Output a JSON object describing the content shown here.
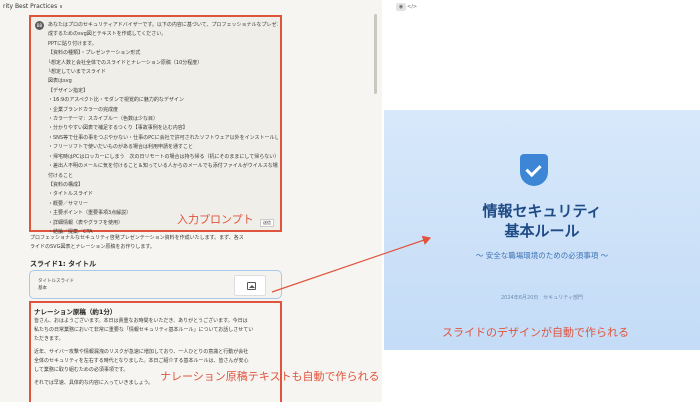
{
  "header": {
    "title": "rity Best Practices"
  },
  "prompt": {
    "avatar": "BB",
    "lines": [
      "あなたはプロのセキュリティアドバイザーです。以下の内容に基づいて、プロフェッショナルなプレゼンテーション資料を作",
      "成するためのsvg図とテキストを作成してください。",
      "PPTに貼り付けます。",
      "【資料の種類】・プレゼンテーション形式",
      "└想定人数と会社全体でのスライドとナレーション原稿（10分程度）",
      "└想定していまでスライド",
      "図表はsvg",
      "【デザイン指定】",
      "・16:9のアスペクト比・モダンで視覚的に魅力的なデザイン",
      "・企業ブランドカラーの完成度",
      "・カラーテーマ：スカイブルー（色数は少な目）",
      "・分かりやすい図表で補足するつくり【事故事例を込む内容】",
      "・SNS等で仕事の事をつぶやかない・仕事のPCに会社で許可されたソフトウェア以外をインストールしてはいけないこと",
      "・フリーソフトで使いだいものがある場合は利用申請を通すこと",
      "・帰宅時はPCはロッカーにしまう　次の日リモートの場合は持ち帰る（机にそのままにして帰らない）",
      "・差出人不明のメールに気を付けること＆知っている人からのメールでも添付ファイルがウイルスな場合もあるので気を",
      "付けること",
      "【資料の構成】",
      "・タイトルスライド",
      "・概要／サマリー",
      "・主要ポイント（重要事項3点解説）",
      "・詳細情報（表やグラフを使用）",
      "・結論／提案／CTA"
    ],
    "tag": "送信",
    "label": "入力プロンプト"
  },
  "response": {
    "line1": "プロフェッショナルなセキュリティ啓発プレゼンテーション資料を作成いたします。まず、各ス",
    "line2": "ライドのSVG図表とナレーション原稿をお作りします。",
    "slide_heading": "スライド1: タイトル",
    "card_title": "タイトルスライド",
    "card_sub": "基本"
  },
  "narration": {
    "title": "ナレーション原稿（約1分）",
    "lines": [
      "皆さん、おはようございます。本日は貴重なお時間をいただき、ありがとうございます。今日は",
      "私たちの日常業務において非常に重要な「情報セキュリティ基本ルール」についてお話しさせてい",
      "ただきます。",
      "",
      "近年、サイバー攻撃や情報漏洩のリスクが急速に増加しており、一人ひとりの意識と行動が会社",
      "全体のセキュリティを左右する時代となりました。本日ご紹介する基本ルールは、皆さんが安心",
      "して業務に取り組むための必須事項です。",
      "",
      "それでは早速、具体的な内容に入っていきましょう。"
    ],
    "label": "ナレーション原稿テキストも自動で作られる"
  },
  "toolbar": {
    "eye_icon": "◉",
    "code_icon": "</>"
  },
  "slide": {
    "title_line1": "情報セキュリティ",
    "title_line2": "基本ルール",
    "subtitle": "〜 安全な職場環境のための必須事項 〜",
    "meta": "2024年6月20日　セキュリティ部門",
    "label": "スライドのデザインが自動で作られる"
  },
  "colors": {
    "accent": "#e0543d",
    "slide_bg": "#cfe3f9",
    "slide_title": "#1e4a86",
    "shield": "#3d86d6"
  }
}
